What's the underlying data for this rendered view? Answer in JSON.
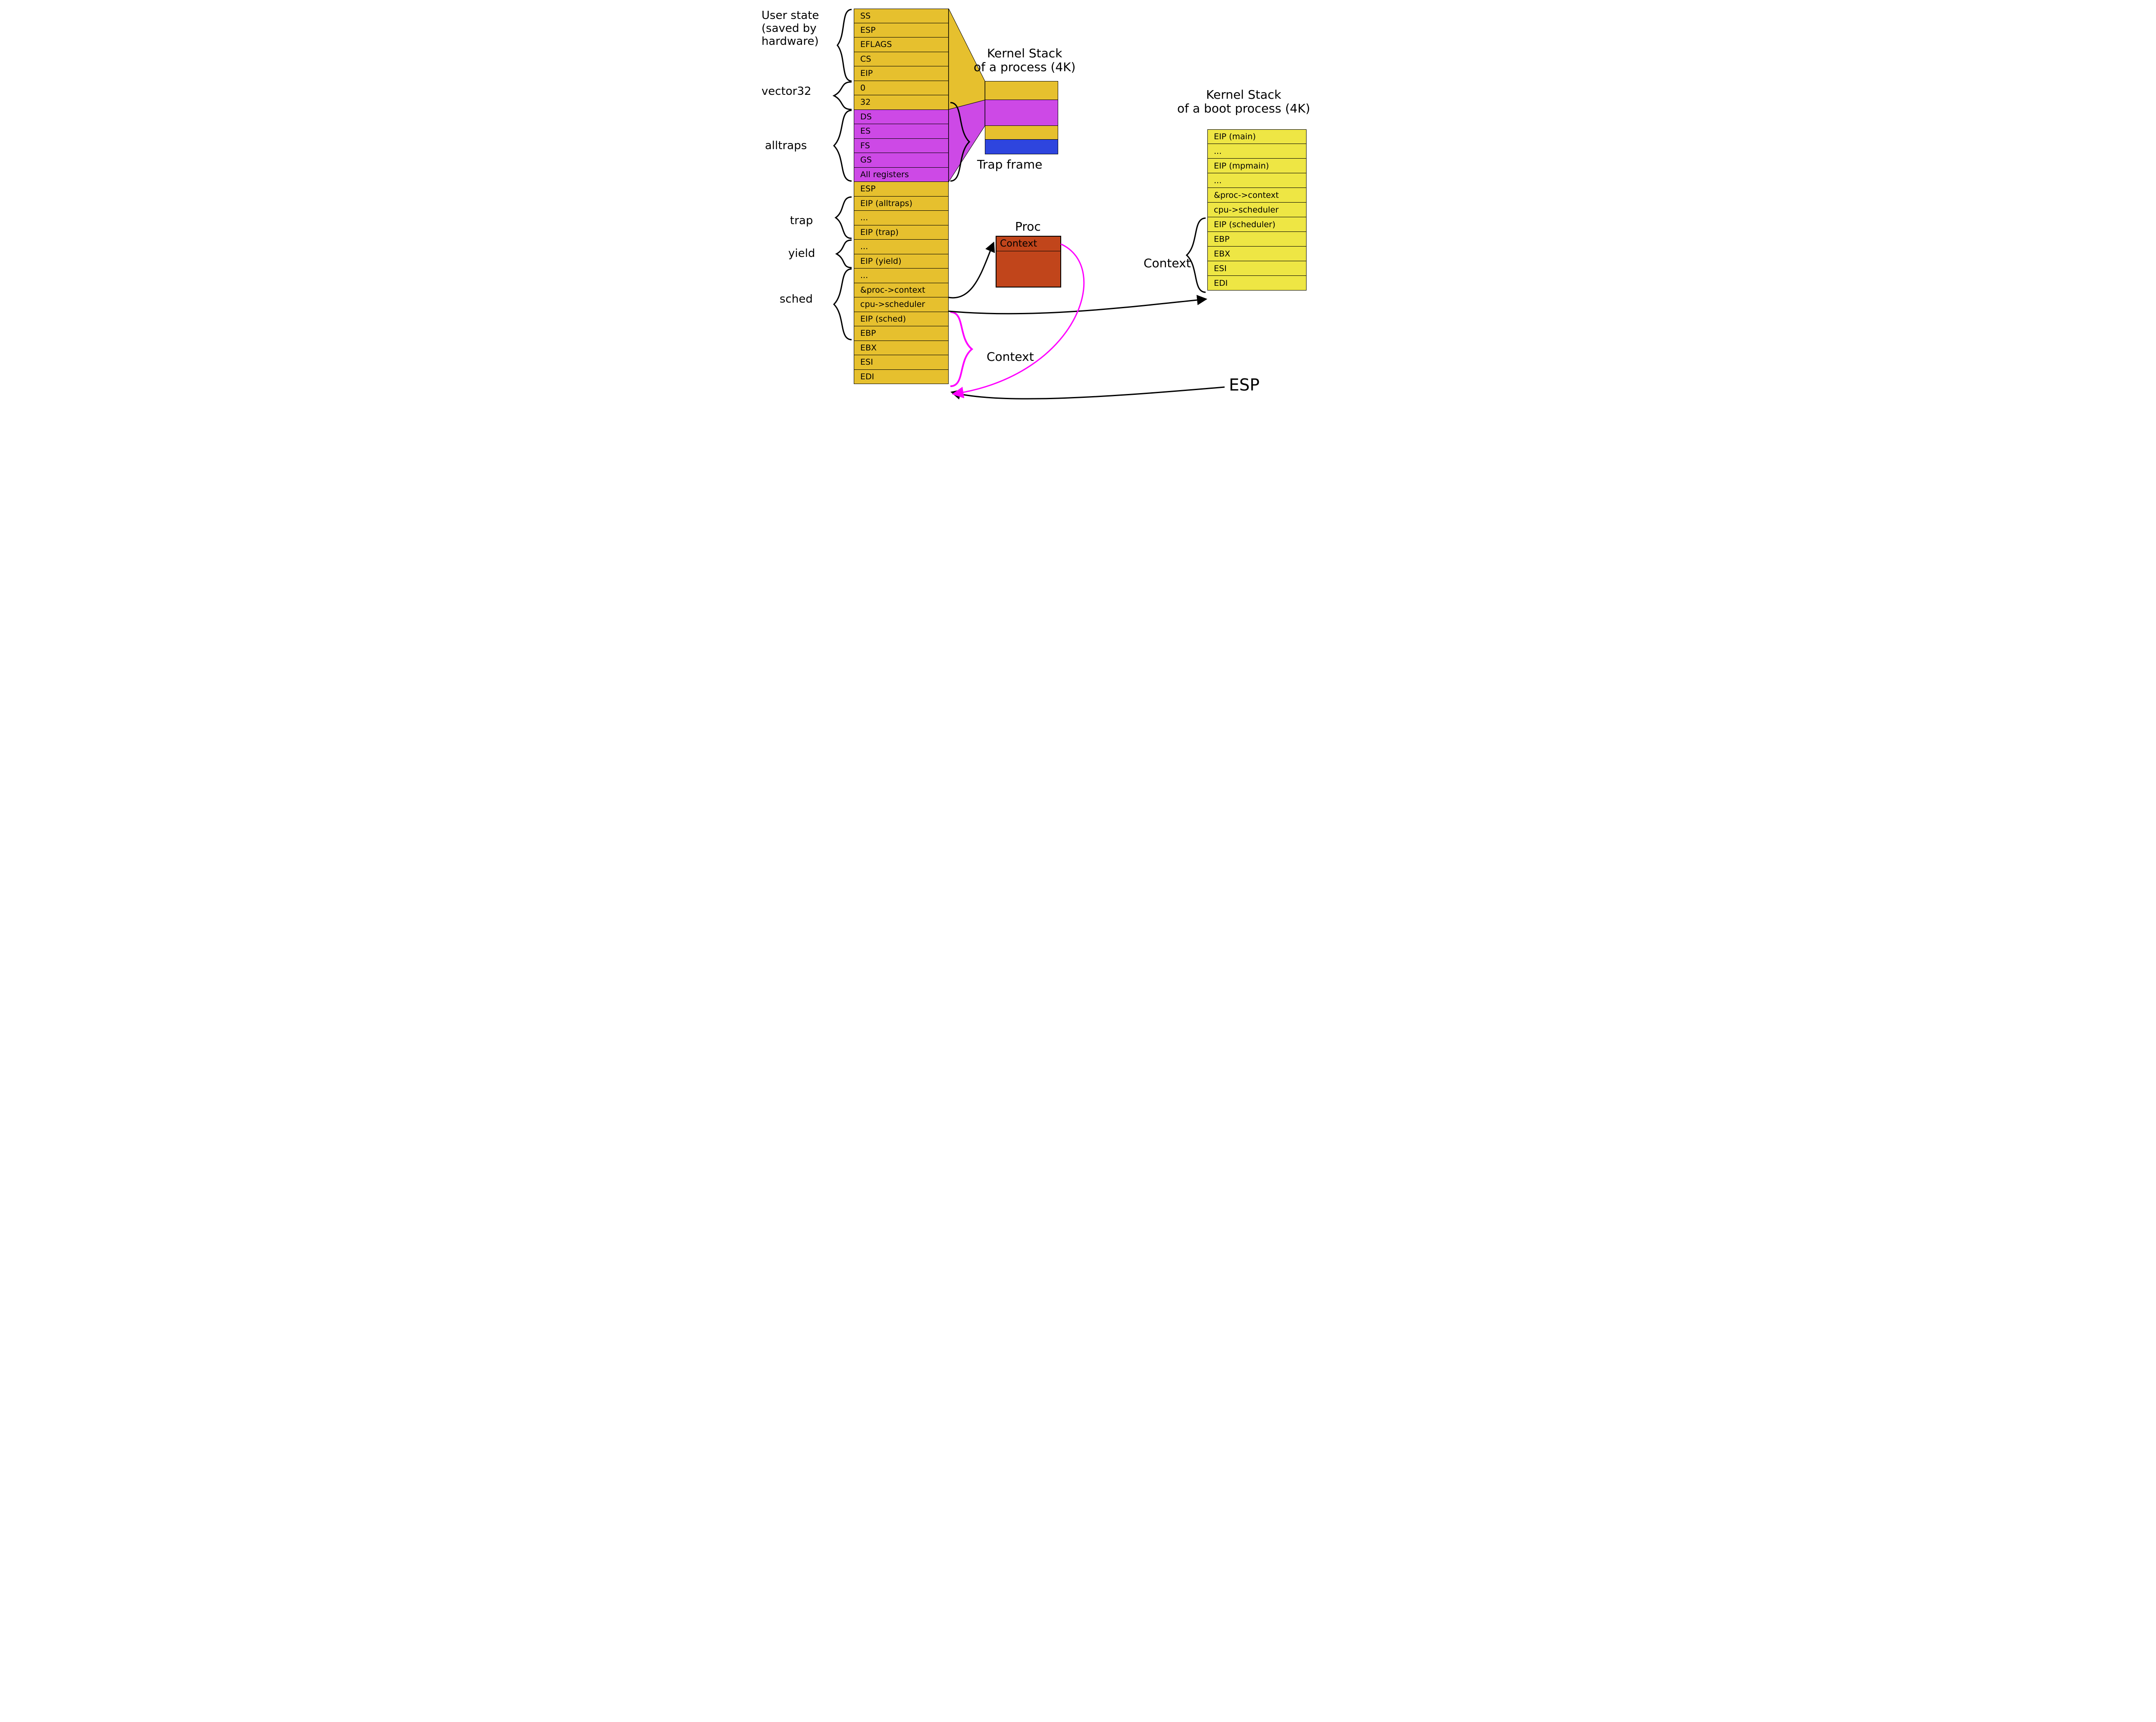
{
  "labels": {
    "user_state": "User state\n(saved by\nhardware)",
    "vector32": "vector32",
    "alltraps": "alltraps",
    "trap": "trap",
    "yield": "yield",
    "sched": "sched",
    "kstack_proc": "Kernel Stack\nof a process (4K)",
    "trap_frame": "Trap frame",
    "proc_title": "Proc",
    "proc_field": "Context",
    "context_label_left": "Context",
    "kstack_boot": "Kernel Stack\nof a boot process (4K)",
    "context_label_right": "Context",
    "esp_big": "ESP"
  },
  "main_stack": [
    {
      "t": "SS",
      "c": "yellow"
    },
    {
      "t": "ESP",
      "c": "yellow"
    },
    {
      "t": "EFLAGS",
      "c": "yellow"
    },
    {
      "t": "CS",
      "c": "yellow"
    },
    {
      "t": "EIP",
      "c": "yellow"
    },
    {
      "t": "0",
      "c": "yellow"
    },
    {
      "t": "32",
      "c": "yellow"
    },
    {
      "t": "DS",
      "c": "magenta"
    },
    {
      "t": "ES",
      "c": "magenta"
    },
    {
      "t": "FS",
      "c": "magenta"
    },
    {
      "t": "GS",
      "c": "magenta"
    },
    {
      "t": "All registers",
      "c": "magenta"
    },
    {
      "t": "ESP",
      "c": "yellow"
    },
    {
      "t": "EIP (alltraps)",
      "c": "yellow"
    },
    {
      "t": "...",
      "c": "yellow"
    },
    {
      "t": "EIP (trap)",
      "c": "yellow"
    },
    {
      "t": "...",
      "c": "yellow"
    },
    {
      "t": "EIP (yield)",
      "c": "yellow"
    },
    {
      "t": "...",
      "c": "yellow"
    },
    {
      "t": "&proc->context",
      "c": "yellow"
    },
    {
      "t": "cpu->scheduler",
      "c": "yellow"
    },
    {
      "t": "EIP (sched)",
      "c": "yellow"
    },
    {
      "t": "EBP",
      "c": "yellow"
    },
    {
      "t": "EBX",
      "c": "yellow"
    },
    {
      "t": "ESI",
      "c": "yellow"
    },
    {
      "t": "EDI",
      "c": "yellow"
    }
  ],
  "kstack_proc": [
    {
      "c": "yellow",
      "h": 44
    },
    {
      "c": "magenta",
      "h": 60
    },
    {
      "c": "yellow",
      "h": 32
    },
    {
      "c": "blue",
      "h": 34
    }
  ],
  "boot_stack": [
    {
      "t": "EIP (main)",
      "c": "yellow2"
    },
    {
      "t": "...",
      "c": "yellow2"
    },
    {
      "t": "EIP (mpmain)",
      "c": "yellow2"
    },
    {
      "t": "...",
      "c": "yellow2"
    },
    {
      "t": "&proc->context",
      "c": "yellow2"
    },
    {
      "t": "cpu->scheduler",
      "c": "yellow2"
    },
    {
      "t": "EIP (scheduler)",
      "c": "yellow2"
    },
    {
      "t": "EBP",
      "c": "yellow2"
    },
    {
      "t": "EBX",
      "c": "yellow2"
    },
    {
      "t": "ESI",
      "c": "yellow2"
    },
    {
      "t": "EDI",
      "c": "yellow2"
    }
  ]
}
